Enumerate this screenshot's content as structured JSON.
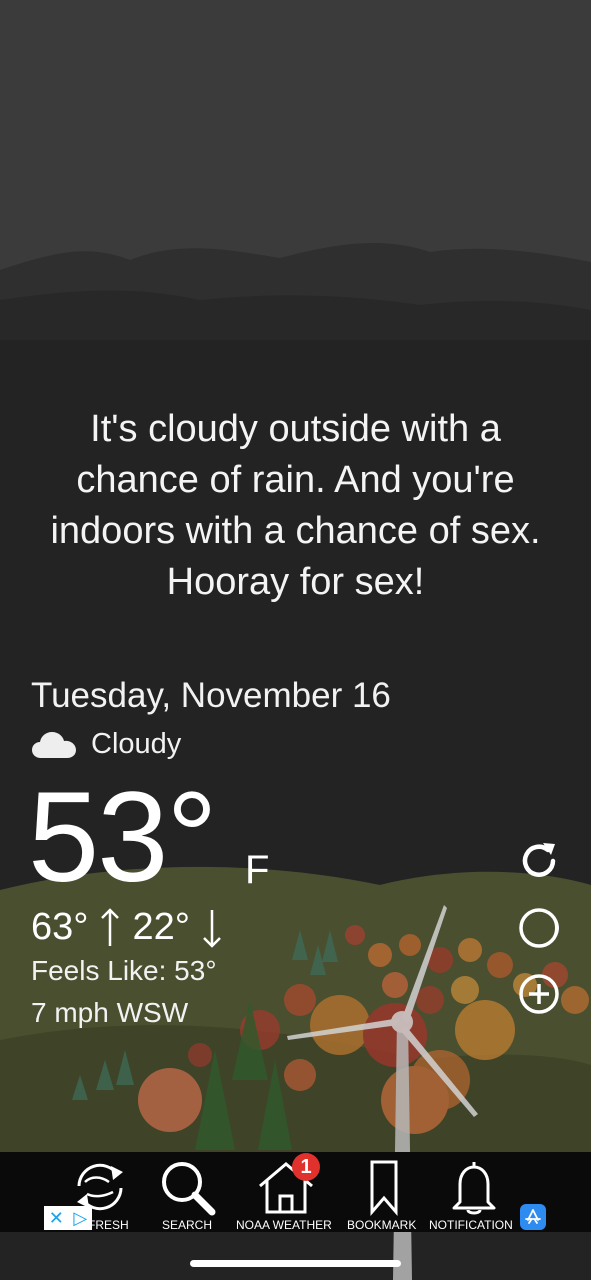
{
  "message": "It's cloudy outside with a chance of rain. And you're indoors with a chance of sex. Hooray for sex!",
  "weather": {
    "date": "Tuesday, November 16",
    "condition": "Cloudy",
    "condition_icon": "cloud-icon",
    "temperature": "53°",
    "unit": "F",
    "high": "63°",
    "low": "22°",
    "feels_like": "Feels Like: 53°",
    "wind": "7 mph WSW"
  },
  "side_actions": [
    {
      "icon": "refresh-icon"
    },
    {
      "icon": "moon-icon"
    },
    {
      "icon": "add-icon"
    }
  ],
  "tabbar": {
    "items": [
      {
        "label": "FRESH",
        "icon": "refresh-icon"
      },
      {
        "label": "SEARCH",
        "icon": "search-icon"
      },
      {
        "label": "NOAA WEATHER",
        "icon": "home-icon",
        "badge": "1"
      },
      {
        "label": "BOOKMARK",
        "icon": "bookmark-icon"
      },
      {
        "label": "NOTIFICATION",
        "icon": "bell-icon"
      }
    ]
  },
  "ad": {
    "close_glyph": "✕",
    "play_glyph": "▷"
  },
  "colors": {
    "background": "#232323",
    "hills": "#4a4f30",
    "badge": "#e0312d",
    "tabbar": "#0a0a0a"
  }
}
